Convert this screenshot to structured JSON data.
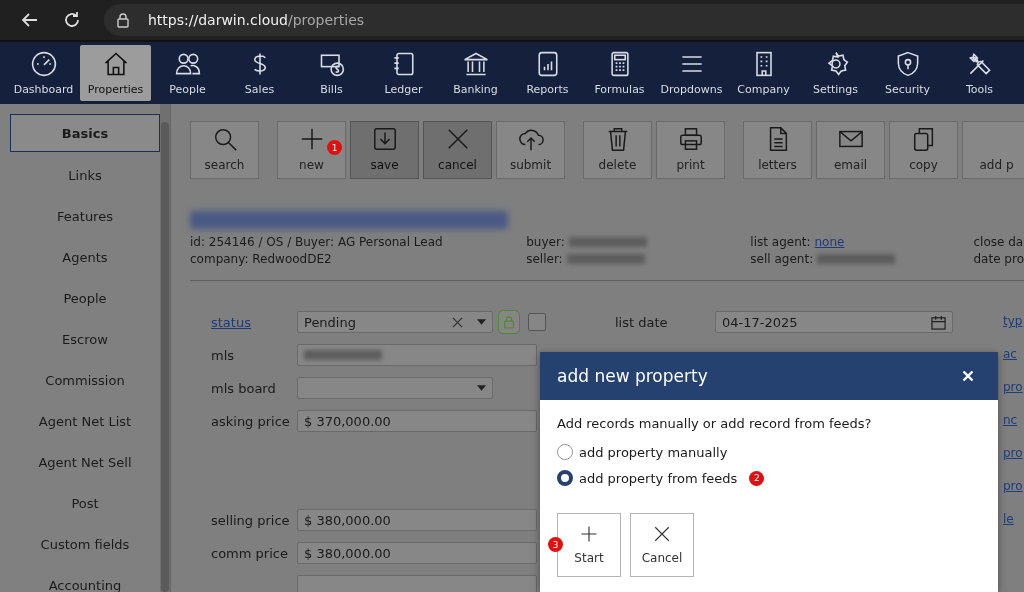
{
  "browser": {
    "url_host": "https://darwin.cloud",
    "url_path": "/properties"
  },
  "nav": [
    {
      "label": "Dashboard",
      "kind": "gauge",
      "selected": false
    },
    {
      "label": "Properties",
      "kind": "house",
      "selected": true
    },
    {
      "label": "People",
      "kind": "people",
      "selected": false
    },
    {
      "label": "Sales",
      "kind": "dollar",
      "selected": false
    },
    {
      "label": "Bills",
      "kind": "bills",
      "selected": false
    },
    {
      "label": "Ledger",
      "kind": "notebook",
      "selected": false
    },
    {
      "label": "Banking",
      "kind": "bank",
      "selected": false
    },
    {
      "label": "Reports",
      "kind": "report",
      "selected": false
    },
    {
      "label": "Formulas",
      "kind": "calculator",
      "selected": false
    },
    {
      "label": "Dropdowns",
      "kind": "lines",
      "selected": false
    },
    {
      "label": "Company",
      "kind": "building",
      "selected": false
    },
    {
      "label": "Settings",
      "kind": "gear",
      "selected": false
    },
    {
      "label": "Security",
      "kind": "shield",
      "selected": false
    },
    {
      "label": "Tools",
      "kind": "tools",
      "selected": false
    }
  ],
  "sidebar": [
    {
      "label": "Basics",
      "selected": true
    },
    {
      "label": "Links",
      "selected": false
    },
    {
      "label": "Features",
      "selected": false
    },
    {
      "label": "Agents",
      "selected": false
    },
    {
      "label": "People",
      "selected": false
    },
    {
      "label": "Escrow",
      "selected": false
    },
    {
      "label": "Commission",
      "selected": false
    },
    {
      "label": "Agent Net List",
      "selected": false
    },
    {
      "label": "Agent Net Sell",
      "selected": false
    },
    {
      "label": "Post",
      "selected": false
    },
    {
      "label": "Custom fields",
      "selected": false
    },
    {
      "label": "Accounting",
      "selected": false
    }
  ],
  "toolbar": [
    [
      {
        "label": "search",
        "kind": "search",
        "pressed": false
      }
    ],
    [
      {
        "label": "new",
        "kind": "plus",
        "pressed": false,
        "badge": "1"
      },
      {
        "label": "save",
        "kind": "save",
        "pressed": true
      },
      {
        "label": "cancel",
        "kind": "x",
        "pressed": true
      },
      {
        "label": "submit",
        "kind": "upload",
        "pressed": false
      }
    ],
    [
      {
        "label": "delete",
        "kind": "trash",
        "pressed": false
      },
      {
        "label": "print",
        "kind": "printer",
        "pressed": false
      }
    ],
    [
      {
        "label": "letters",
        "kind": "doc",
        "pressed": false
      },
      {
        "label": "email",
        "kind": "mail",
        "pressed": false
      },
      {
        "label": "copy",
        "kind": "copy",
        "pressed": false
      },
      {
        "label": "add p",
        "kind": "none",
        "pressed": false
      }
    ]
  ],
  "record": {
    "columns": [
      [
        {
          "label": "id: 254146 / OS / Buyer: AG Personal Lead"
        },
        {
          "label": "company: RedwoodDE2"
        }
      ],
      [
        {
          "label": "buyer:",
          "redacted": true
        },
        {
          "label": "seller:",
          "redacted": true
        }
      ],
      [
        {
          "label": "list agent:",
          "link": "none"
        },
        {
          "label": "sell agent:",
          "redacted": true
        }
      ],
      [
        {
          "label": "close da"
        },
        {
          "label": "date pro"
        }
      ]
    ]
  },
  "form": [
    {
      "label": "status",
      "kind": "select",
      "link": true,
      "value": "Pending",
      "clearable": true,
      "locked": true,
      "checked": false
    },
    {
      "label": "mls",
      "kind": "text",
      "redacted": true
    },
    {
      "label": "mls board",
      "kind": "select"
    },
    {
      "label": "asking price",
      "kind": "text",
      "value": "$ 370,000.00"
    },
    {
      "kind": "gap"
    },
    {
      "label": "selling price",
      "kind": "text",
      "value": "$ 380,000.00"
    },
    {
      "label": "comm price",
      "kind": "text",
      "value": "$ 380,000.00"
    },
    {
      "kind": "text"
    }
  ],
  "list_date": {
    "label": "list date",
    "value": "04-17-2025"
  },
  "right_edge": [
    "typ",
    "ac",
    "pro",
    "nc",
    "pro",
    "pro",
    "le"
  ],
  "modal": {
    "title": "add new property",
    "question": "Add records manually or add record from feeds?",
    "options": [
      {
        "label": "add property manually",
        "selected": false
      },
      {
        "label": "add property from feeds",
        "selected": true,
        "badge": "2"
      }
    ],
    "buttons": [
      {
        "label": "Start",
        "kind": "plus",
        "badge": "3"
      },
      {
        "label": "Cancel",
        "kind": "x"
      }
    ]
  }
}
